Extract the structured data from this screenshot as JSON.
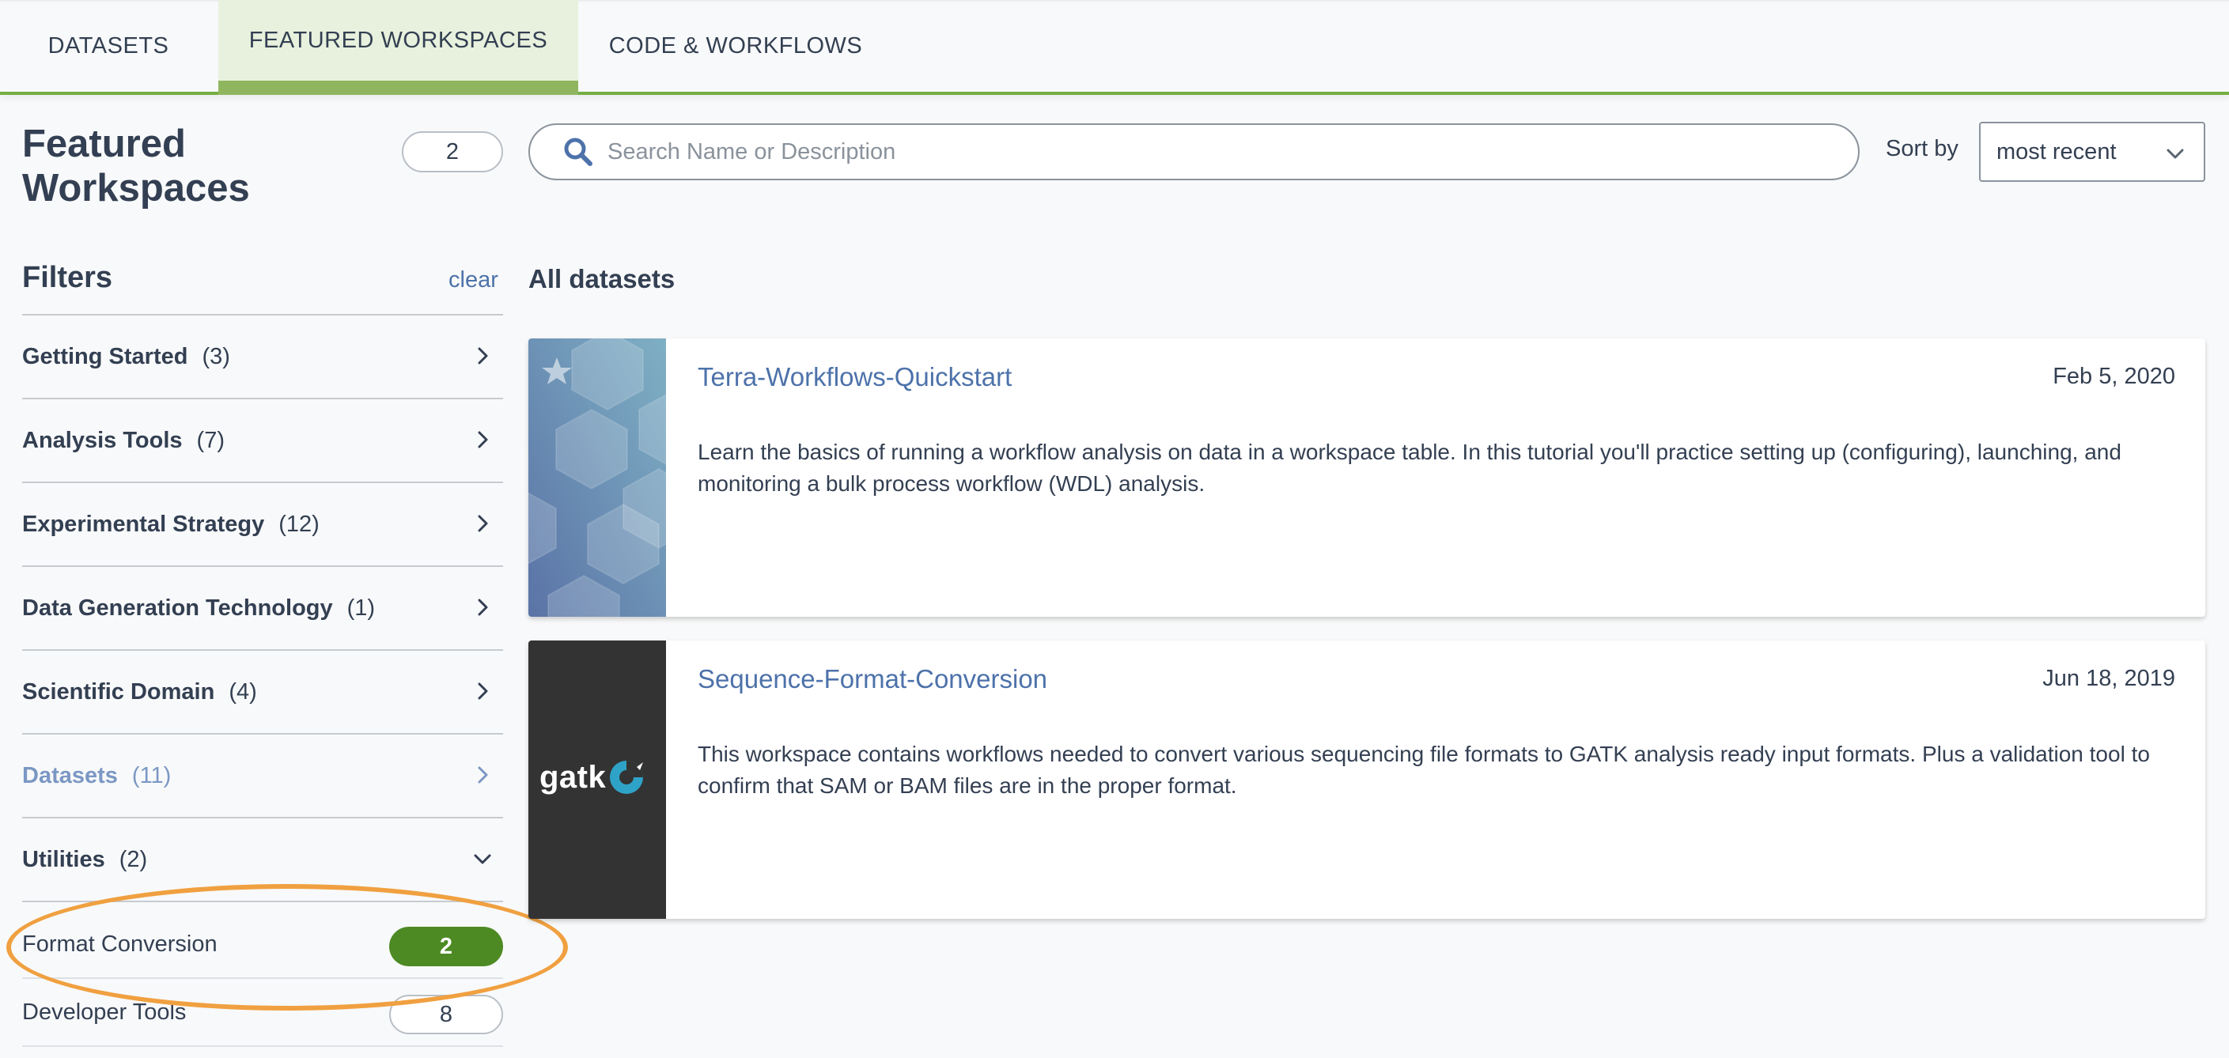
{
  "tabs": [
    {
      "label": "DATASETS",
      "active": false
    },
    {
      "label": "FEATURED WORKSPACES",
      "active": true
    },
    {
      "label": "CODE & WORKFLOWS",
      "active": false
    }
  ],
  "header": {
    "title": "Featured Workspaces",
    "result_count": "2",
    "search_placeholder": "Search Name or Description",
    "search_value": "",
    "sort_label": "Sort by",
    "sort_value": "most recent"
  },
  "filters": {
    "title": "Filters",
    "clear_label": "clear",
    "sections": [
      {
        "label": "Getting Started",
        "count": "(3)",
        "expanded": false
      },
      {
        "label": "Analysis Tools",
        "count": "(7)",
        "expanded": false
      },
      {
        "label": "Experimental Strategy",
        "count": "(12)",
        "expanded": false
      },
      {
        "label": "Data Generation Technology",
        "count": "(1)",
        "expanded": false
      },
      {
        "label": "Scientific Domain",
        "count": "(4)",
        "expanded": false
      },
      {
        "label": "Datasets",
        "count": "(11)",
        "expanded": false
      },
      {
        "label": "Utilities",
        "count": "(2)",
        "expanded": true
      }
    ],
    "utilities_items": [
      {
        "label": "Format Conversion",
        "count": "2",
        "selected": true
      },
      {
        "label": "Developer Tools",
        "count": "8",
        "selected": false
      }
    ]
  },
  "results": {
    "title": "All datasets",
    "cards": [
      {
        "title": "Terra-Workflows-Quickstart",
        "date": "Feb 5, 2020",
        "description": "Learn the basics of running a workflow analysis on data in a workspace table. In this tutorial you'll practice setting up (configuring), launching, and monitoring a bulk process workflow (WDL) analysis.",
        "thumbnail": "hexagon-pattern",
        "featured_icon": "star-icon"
      },
      {
        "title": "Sequence-Format-Conversion",
        "date": "Jun 18, 2019",
        "description": "This workspace contains workflows needed to convert various sequencing file formats to GATK analysis ready input formats. Plus a validation tool to confirm that SAM or BAM files are in the proper format.",
        "thumbnail": "gatk-logo",
        "logo_text": "gatk"
      }
    ]
  },
  "colors": {
    "accent_green": "#74ae43",
    "selected_pill": "#4d8a24",
    "link_blue": "#4d72aa",
    "highlight_orange": "#f0a040"
  }
}
